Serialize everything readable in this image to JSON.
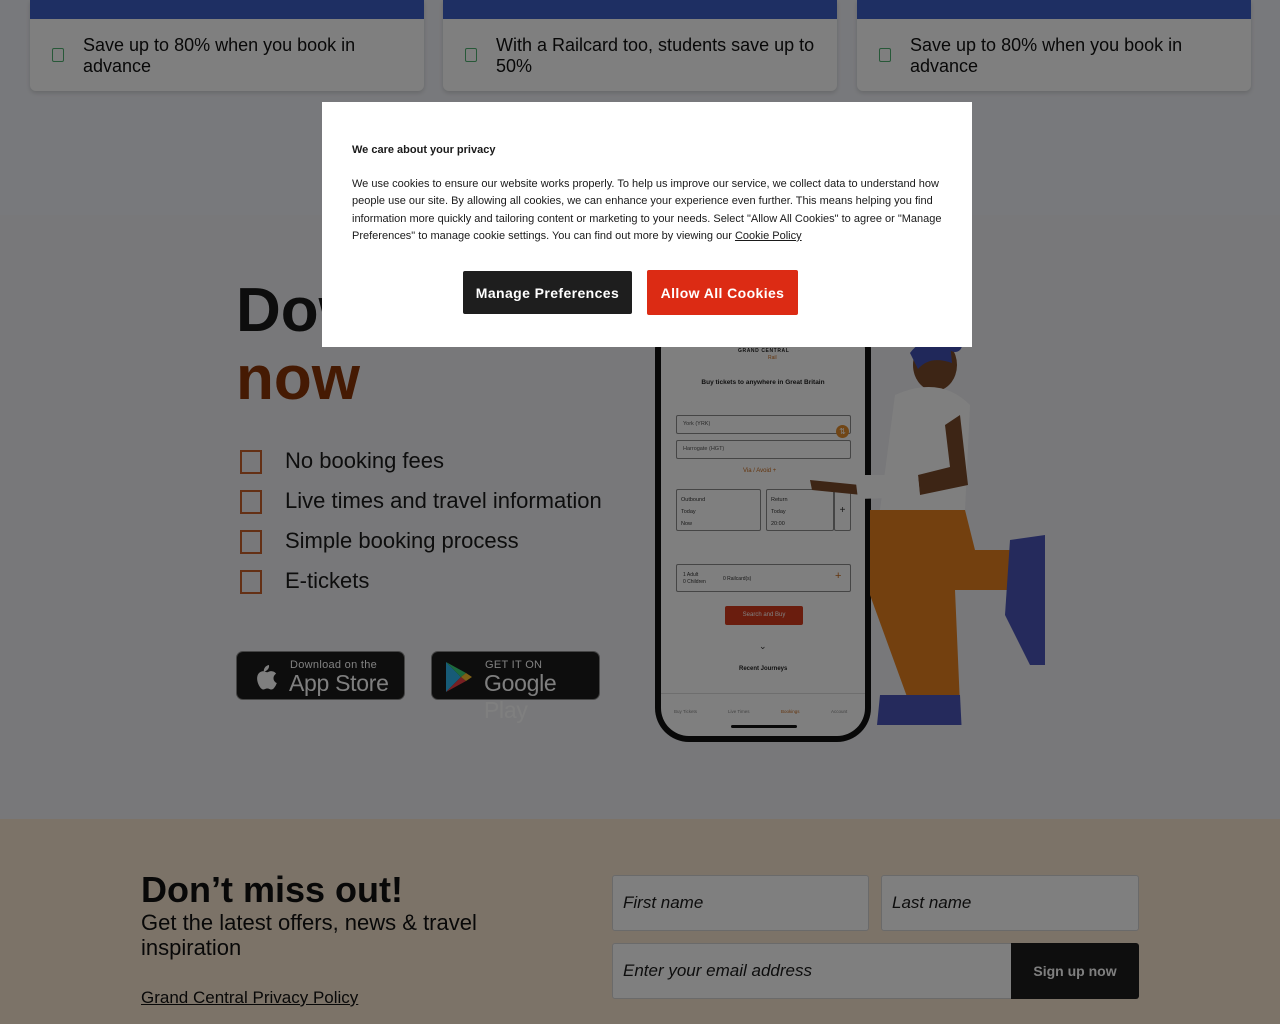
{
  "benefit_cards": [
    {
      "text": "Save up to 80% when you book in advance"
    },
    {
      "text": "With a Railcard too, students save up to 50%"
    },
    {
      "text": "Save up to 80% when you book in advance"
    }
  ],
  "app_section": {
    "title_line1": "Download our app",
    "title_line2": "now",
    "features": [
      "No booking fees",
      "Live times and travel information",
      "Simple booking process",
      "E-tickets"
    ],
    "app_store": {
      "small": "Download on the",
      "big": "App Store"
    },
    "google_play": {
      "small": "GET IT ON",
      "big": "Google Play"
    }
  },
  "phone": {
    "brand": "GRAND CENTRAL",
    "brand_sub": "Rail",
    "heading": "Buy tickets to anywhere in Great Britain",
    "from": "York (YRK)",
    "to": "Harrogate (HGT)",
    "via": "Via / Avoid +",
    "outbound": {
      "label": "Outbound",
      "day": "Today",
      "time": "Now"
    },
    "return": {
      "label": "Return",
      "day": "Today",
      "time": "20:00"
    },
    "passengers": "1 Adult",
    "children": "0 Children",
    "railcards": "0 Railcard(s)",
    "search": "Search and Buy",
    "recent": "Recent Journeys",
    "nav": [
      "Buy Tickets",
      "Live Times",
      "Bookings",
      "Account"
    ]
  },
  "newsletter": {
    "title": "Don’t miss out!",
    "subtitle": "Get the latest offers, news & travel inspiration",
    "policy_link": "Grand Central Privacy Policy",
    "first_name_placeholder": "First name",
    "last_name_placeholder": "Last name",
    "email_placeholder": "Enter your email address",
    "signup_label": "Sign up now"
  },
  "cookie_modal": {
    "title": "We care about your privacy",
    "body": " We use cookies to ensure our website works properly. To help us improve our service, we collect data to understand how people use our site. By allowing all cookies, we can enhance your experience even further. This means helping you find information more quickly and tailoring content or marketing to your needs. Select \"Allow All Cookies\" to agree or \"Manage Preferences\" to manage cookie settings. You can find out more by viewing our",
    "policy_link": "Cookie Policy",
    "manage_label": "Manage Preferences",
    "allow_label": "Allow All Cookies"
  },
  "colors": {
    "card_bar": "#3c5fc6",
    "accent_orange": "#c8612a",
    "title_brown": "#8a3407",
    "allow_button": "#dc2b14",
    "newsletter_bg": "#f9e6d0"
  }
}
